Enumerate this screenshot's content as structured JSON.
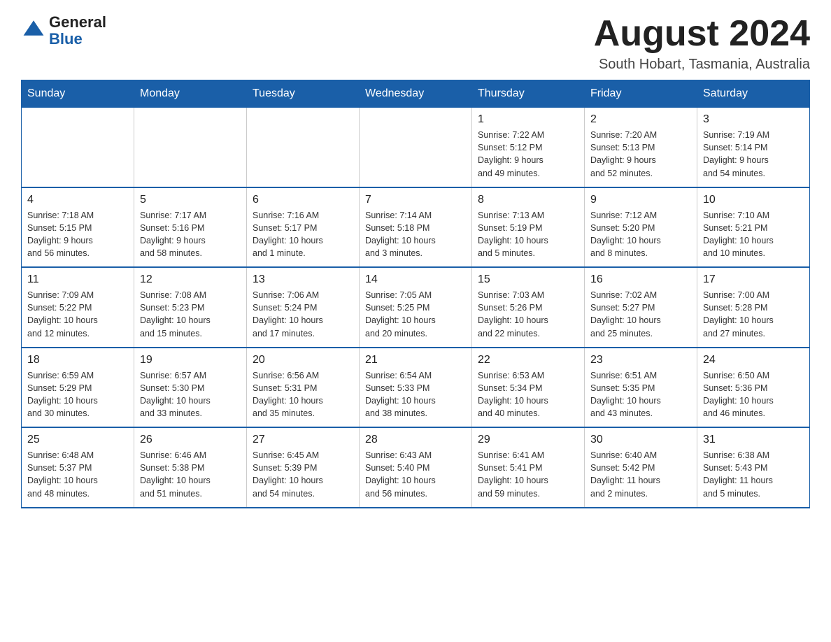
{
  "header": {
    "logo_general": "General",
    "logo_blue": "Blue",
    "month_title": "August 2024",
    "location": "South Hobart, Tasmania, Australia"
  },
  "days_of_week": [
    "Sunday",
    "Monday",
    "Tuesday",
    "Wednesday",
    "Thursday",
    "Friday",
    "Saturday"
  ],
  "weeks": [
    [
      {
        "day": "",
        "info": ""
      },
      {
        "day": "",
        "info": ""
      },
      {
        "day": "",
        "info": ""
      },
      {
        "day": "",
        "info": ""
      },
      {
        "day": "1",
        "info": "Sunrise: 7:22 AM\nSunset: 5:12 PM\nDaylight: 9 hours\nand 49 minutes."
      },
      {
        "day": "2",
        "info": "Sunrise: 7:20 AM\nSunset: 5:13 PM\nDaylight: 9 hours\nand 52 minutes."
      },
      {
        "day": "3",
        "info": "Sunrise: 7:19 AM\nSunset: 5:14 PM\nDaylight: 9 hours\nand 54 minutes."
      }
    ],
    [
      {
        "day": "4",
        "info": "Sunrise: 7:18 AM\nSunset: 5:15 PM\nDaylight: 9 hours\nand 56 minutes."
      },
      {
        "day": "5",
        "info": "Sunrise: 7:17 AM\nSunset: 5:16 PM\nDaylight: 9 hours\nand 58 minutes."
      },
      {
        "day": "6",
        "info": "Sunrise: 7:16 AM\nSunset: 5:17 PM\nDaylight: 10 hours\nand 1 minute."
      },
      {
        "day": "7",
        "info": "Sunrise: 7:14 AM\nSunset: 5:18 PM\nDaylight: 10 hours\nand 3 minutes."
      },
      {
        "day": "8",
        "info": "Sunrise: 7:13 AM\nSunset: 5:19 PM\nDaylight: 10 hours\nand 5 minutes."
      },
      {
        "day": "9",
        "info": "Sunrise: 7:12 AM\nSunset: 5:20 PM\nDaylight: 10 hours\nand 8 minutes."
      },
      {
        "day": "10",
        "info": "Sunrise: 7:10 AM\nSunset: 5:21 PM\nDaylight: 10 hours\nand 10 minutes."
      }
    ],
    [
      {
        "day": "11",
        "info": "Sunrise: 7:09 AM\nSunset: 5:22 PM\nDaylight: 10 hours\nand 12 minutes."
      },
      {
        "day": "12",
        "info": "Sunrise: 7:08 AM\nSunset: 5:23 PM\nDaylight: 10 hours\nand 15 minutes."
      },
      {
        "day": "13",
        "info": "Sunrise: 7:06 AM\nSunset: 5:24 PM\nDaylight: 10 hours\nand 17 minutes."
      },
      {
        "day": "14",
        "info": "Sunrise: 7:05 AM\nSunset: 5:25 PM\nDaylight: 10 hours\nand 20 minutes."
      },
      {
        "day": "15",
        "info": "Sunrise: 7:03 AM\nSunset: 5:26 PM\nDaylight: 10 hours\nand 22 minutes."
      },
      {
        "day": "16",
        "info": "Sunrise: 7:02 AM\nSunset: 5:27 PM\nDaylight: 10 hours\nand 25 minutes."
      },
      {
        "day": "17",
        "info": "Sunrise: 7:00 AM\nSunset: 5:28 PM\nDaylight: 10 hours\nand 27 minutes."
      }
    ],
    [
      {
        "day": "18",
        "info": "Sunrise: 6:59 AM\nSunset: 5:29 PM\nDaylight: 10 hours\nand 30 minutes."
      },
      {
        "day": "19",
        "info": "Sunrise: 6:57 AM\nSunset: 5:30 PM\nDaylight: 10 hours\nand 33 minutes."
      },
      {
        "day": "20",
        "info": "Sunrise: 6:56 AM\nSunset: 5:31 PM\nDaylight: 10 hours\nand 35 minutes."
      },
      {
        "day": "21",
        "info": "Sunrise: 6:54 AM\nSunset: 5:33 PM\nDaylight: 10 hours\nand 38 minutes."
      },
      {
        "day": "22",
        "info": "Sunrise: 6:53 AM\nSunset: 5:34 PM\nDaylight: 10 hours\nand 40 minutes."
      },
      {
        "day": "23",
        "info": "Sunrise: 6:51 AM\nSunset: 5:35 PM\nDaylight: 10 hours\nand 43 minutes."
      },
      {
        "day": "24",
        "info": "Sunrise: 6:50 AM\nSunset: 5:36 PM\nDaylight: 10 hours\nand 46 minutes."
      }
    ],
    [
      {
        "day": "25",
        "info": "Sunrise: 6:48 AM\nSunset: 5:37 PM\nDaylight: 10 hours\nand 48 minutes."
      },
      {
        "day": "26",
        "info": "Sunrise: 6:46 AM\nSunset: 5:38 PM\nDaylight: 10 hours\nand 51 minutes."
      },
      {
        "day": "27",
        "info": "Sunrise: 6:45 AM\nSunset: 5:39 PM\nDaylight: 10 hours\nand 54 minutes."
      },
      {
        "day": "28",
        "info": "Sunrise: 6:43 AM\nSunset: 5:40 PM\nDaylight: 10 hours\nand 56 minutes."
      },
      {
        "day": "29",
        "info": "Sunrise: 6:41 AM\nSunset: 5:41 PM\nDaylight: 10 hours\nand 59 minutes."
      },
      {
        "day": "30",
        "info": "Sunrise: 6:40 AM\nSunset: 5:42 PM\nDaylight: 11 hours\nand 2 minutes."
      },
      {
        "day": "31",
        "info": "Sunrise: 6:38 AM\nSunset: 5:43 PM\nDaylight: 11 hours\nand 5 minutes."
      }
    ]
  ]
}
